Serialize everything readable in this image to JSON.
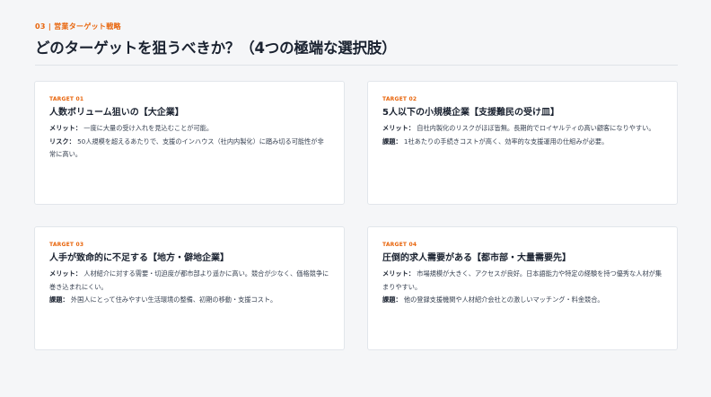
{
  "header": {
    "kicker": "03 | 営業ターゲット戦略",
    "title": "どのターゲットを狙うべきか？（4つの極端な選択肢）"
  },
  "cards": [
    {
      "tag": "TARGET 01",
      "title": "人数ボリューム狙いの【大企業】",
      "merit_label": "メリット：",
      "merit": "一度に大量の受け入れを見込むことが可能。",
      "second_label": "リスク：",
      "second": "50人規模を超えるあたりで、支援のインハウス（社内内製化）に踏み切る可能性が非常に高い。"
    },
    {
      "tag": "TARGET 02",
      "title": "5人以下の小規模企業【支援難民の受け皿】",
      "merit_label": "メリット：",
      "merit": "自社内製化のリスクがほぼ皆無。長期的でロイヤルティの高い顧客になりやすい。",
      "second_label": "課題：",
      "second": "1社あたりの手続きコストが高く、効率的な支援運用の仕組みが必要。"
    },
    {
      "tag": "TARGET 03",
      "title": "人手が致命的に不足する【地方・僻地企業】",
      "merit_label": "メリット：",
      "merit": "人材紹介に対する需要・切迫度が都市部より遥かに高い。競合が少なく、価格競争に巻き込まれにくい。",
      "second_label": "課題：",
      "second": "外国人にとって住みやすい生活環境の整備、初期の移動・支援コスト。"
    },
    {
      "tag": "TARGET 04",
      "title": "圧倒的求人需要がある【都市部・大量需要先】",
      "merit_label": "メリット：",
      "merit": "市場規模が大きく、アクセスが良好。日本語能力や特定の経験を持つ優秀な人材が集まりやすい。",
      "second_label": "課題：",
      "second": "他の登録支援機関や人材紹介会社との激しいマッチング・料金競合。"
    }
  ],
  "colors": {
    "accent": "#e8650c",
    "heading": "#1a2230",
    "background": "#f5f6f8",
    "card": "#ffffff"
  }
}
